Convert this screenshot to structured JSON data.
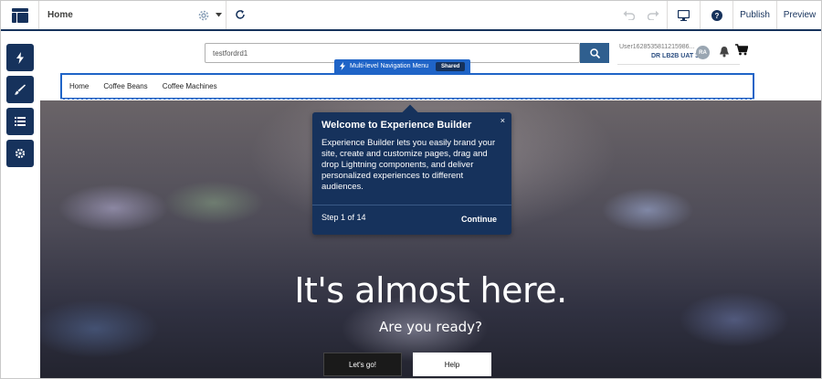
{
  "toolbar": {
    "page_name": "Home",
    "publish_label": "Publish",
    "preview_label": "Preview"
  },
  "left_panel": {
    "buttons": [
      "lightning-icon",
      "brush-icon",
      "list-icon",
      "gear-icon"
    ]
  },
  "site": {
    "search_value": "testfordrd1",
    "user_name": "User1628535811215986...",
    "user_org": "DR LB2B UAT 3",
    "avatar_initials": "RA",
    "component_label": "Multi-level Navigation Menu",
    "component_badge": "Shared",
    "nav_items": [
      "Home",
      "Coffee Beans",
      "Coffee Machines"
    ],
    "hero_title": "It's almost here.",
    "hero_subtitle": "Are you ready?",
    "primary_button": "Let's go!",
    "secondary_button": "Help"
  },
  "popover": {
    "title": "Welcome to Experience Builder",
    "body": "Experience Builder lets you easily brand your site, create and customize pages, drag and drop Lightning components, and deliver personalized experiences to different audiences.",
    "step": "Step 1 of 14",
    "continue_label": "Continue",
    "close_symbol": "×"
  },
  "colors": {
    "navy": "#16325c",
    "accent_blue": "#1f64c7",
    "search_button": "#2f5f8f"
  }
}
